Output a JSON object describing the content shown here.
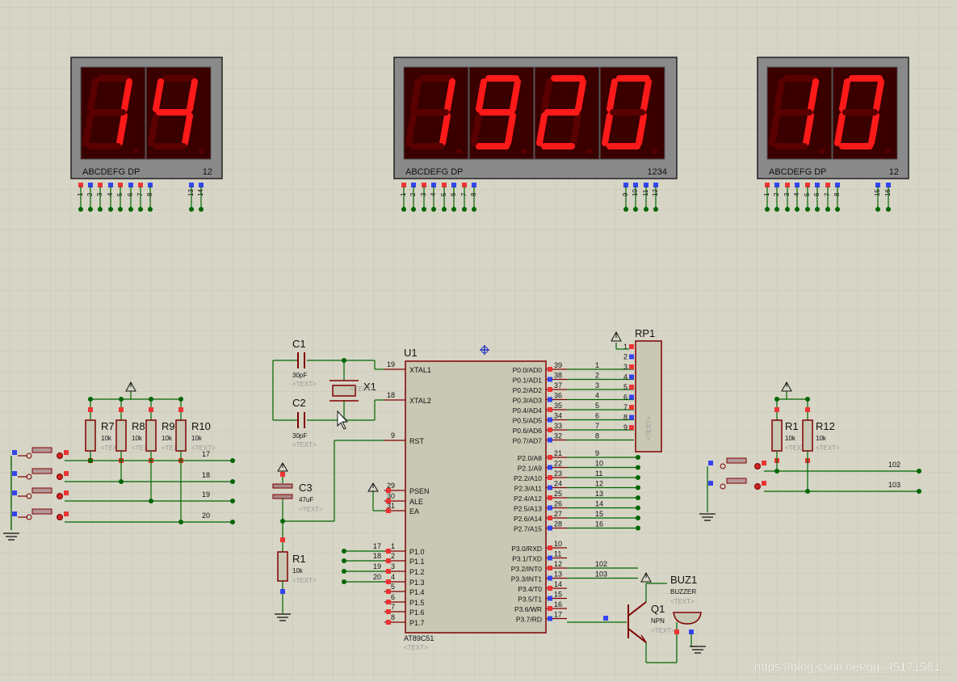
{
  "displays": [
    {
      "id": "left",
      "digits": "14",
      "segment_label": "ABCDEFG  DP",
      "digit_label": "12"
    },
    {
      "id": "middle",
      "digits": "1920",
      "segment_label": "ABCDEFG  DP",
      "digit_label": "1234"
    },
    {
      "id": "right",
      "digits": "10",
      "segment_label": "ABCDEFG  DP",
      "digit_label": "12"
    }
  ],
  "mcu": {
    "ref": "U1",
    "part": "AT89C51",
    "text": "<TEXT>",
    "left_pins": [
      {
        "num": "19",
        "name": "XTAL1"
      },
      {
        "num": "18",
        "name": "XTAL2"
      },
      {
        "num": "9",
        "name": "RST"
      },
      {
        "num": "29",
        "name": "PSEN"
      },
      {
        "num": "30",
        "name": "ALE"
      },
      {
        "num": "31",
        "name": "EA"
      },
      {
        "num": "1",
        "name": "P1.0"
      },
      {
        "num": "2",
        "name": "P1.1"
      },
      {
        "num": "3",
        "name": "P1.2"
      },
      {
        "num": "4",
        "name": "P1.3"
      },
      {
        "num": "5",
        "name": "P1.4"
      },
      {
        "num": "6",
        "name": "P1.5"
      },
      {
        "num": "7",
        "name": "P1.6"
      },
      {
        "num": "8",
        "name": "P1.7"
      }
    ],
    "right_pins": [
      {
        "num": "39",
        "name": "P0.0/AD0",
        "net": "1"
      },
      {
        "num": "38",
        "name": "P0.1/AD1",
        "net": "2"
      },
      {
        "num": "37",
        "name": "P0.2/AD2",
        "net": "3"
      },
      {
        "num": "36",
        "name": "P0.3/AD3",
        "net": "4"
      },
      {
        "num": "35",
        "name": "P0.4/AD4",
        "net": "5"
      },
      {
        "num": "34",
        "name": "P0.5/AD5",
        "net": "6"
      },
      {
        "num": "33",
        "name": "P0.6/AD6",
        "net": "7"
      },
      {
        "num": "32",
        "name": "P0.7/AD7",
        "net": "8"
      },
      {
        "num": "21",
        "name": "P2.0/A8",
        "net": "9"
      },
      {
        "num": "22",
        "name": "P2.1/A9",
        "net": "10"
      },
      {
        "num": "23",
        "name": "P2.2/A10",
        "net": "11"
      },
      {
        "num": "24",
        "name": "P2.3/A11",
        "net": "12"
      },
      {
        "num": "25",
        "name": "P2.4/A12",
        "net": "13"
      },
      {
        "num": "26",
        "name": "P2.5/A13",
        "net": "14"
      },
      {
        "num": "27",
        "name": "P2.6/A14",
        "net": "15"
      },
      {
        "num": "28",
        "name": "P2.7/A15",
        "net": "16"
      },
      {
        "num": "10",
        "name": "P3.0/RXD",
        "net": ""
      },
      {
        "num": "11",
        "name": "P3.1/TXD",
        "net": ""
      },
      {
        "num": "12",
        "name": "P3.2/INT0",
        "net": "102"
      },
      {
        "num": "13",
        "name": "P3.3/INT1",
        "net": "103"
      },
      {
        "num": "14",
        "name": "P3.4/T0",
        "net": ""
      },
      {
        "num": "15",
        "name": "P3.5/T1",
        "net": ""
      },
      {
        "num": "16",
        "name": "P3.6/WR",
        "net": ""
      },
      {
        "num": "17",
        "name": "P3.7/RD",
        "net": ""
      }
    ],
    "p1_nets": [
      "17",
      "18",
      "19",
      "20"
    ]
  },
  "rp1": {
    "ref": "RP1",
    "pins": [
      "1",
      "2",
      "3",
      "4",
      "5",
      "6",
      "7",
      "8",
      "9"
    ],
    "text": "<TEXT>"
  },
  "components": {
    "c1": {
      "ref": "C1",
      "value": "30pF",
      "text": "<TEXT>"
    },
    "c2": {
      "ref": "C2",
      "value": "30pF",
      "text": "<TEXT>"
    },
    "x1": {
      "ref": "X1",
      "text": "<TEXT>"
    },
    "c3": {
      "ref": "C3",
      "value": "47uF",
      "text": "<TEXT>"
    },
    "r1a": {
      "ref": "R1",
      "value": "10k",
      "text": "<TEXT>"
    },
    "r7": {
      "ref": "R7",
      "value": "10k"
    },
    "r8": {
      "ref": "R8",
      "value": "10k"
    },
    "r9": {
      "ref": "R9",
      "value": "10k"
    },
    "r10": {
      "ref": "R10",
      "value": "10k"
    },
    "r1b": {
      "ref": "R1",
      "value": "10k"
    },
    "r12": {
      "ref": "R12",
      "value": "10k"
    },
    "q1": {
      "ref": "Q1",
      "type": "NPN",
      "text": "<TEXT>"
    },
    "buz1": {
      "ref": "BUZ1",
      "type": "BUZZER",
      "text": "<TEXT>"
    }
  },
  "button_nets_left": [
    "17",
    "18",
    "19",
    "20"
  ],
  "button_nets_right": [
    "102",
    "103"
  ],
  "left_display_pins": [
    "1",
    "2",
    "3",
    "4",
    "5",
    "6",
    "7",
    "8",
    "13",
    "14"
  ],
  "middle_display_pins": [
    "1",
    "2",
    "3",
    "4",
    "5",
    "6",
    "7",
    "8",
    "9",
    "10",
    "11",
    "12"
  ],
  "right_display_pins": [
    "1",
    "2",
    "3",
    "4",
    "5",
    "6",
    "7",
    "8",
    "15",
    "16"
  ],
  "watermark": "https://blog.csdn.net/qq_45171581",
  "colors": {
    "background": "#d6d5c6",
    "grid": "#c4c3b4",
    "wire": "#006600",
    "body": "#c8c8b4",
    "outline": "#800000",
    "seg_on": "#ff1a1a",
    "seg_off": "#5a0000",
    "pin_red": "#ee3333",
    "pin_blue": "#3344ee"
  }
}
